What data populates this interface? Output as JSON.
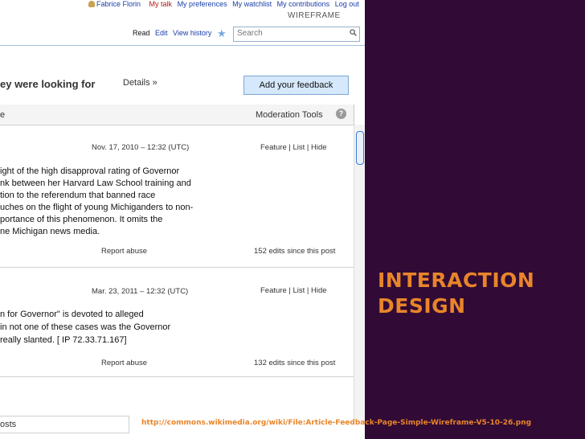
{
  "topbar": {
    "user": "Fabrice Florin",
    "my_talk": "My talk",
    "my_preferences": "My preferences",
    "my_watchlist": "My watchlist",
    "my_contributions": "My contributions",
    "logout": "Log out"
  },
  "wireframe_label": "WIREFRAME",
  "tabs": {
    "read": "Read",
    "edit": "Edit",
    "view_history": "View history"
  },
  "search": {
    "placeholder": "Search"
  },
  "headline": "ey were looking for",
  "details_link": "Details  »",
  "add_feedback_button": "Add your feedback",
  "panel": {
    "header_left": "e",
    "moderation_tools": "Moderation Tools",
    "help": "?"
  },
  "posts": [
    {
      "date": "Nov. 17, 2010 – 12:32 (UTC)",
      "actions": "Feature | List | Hide",
      "lines": [
        "ight of the high disapproval rating of Governor",
        "nk between her Harvard Law School training and",
        "tion to the referendum that banned race",
        "uches on the flight of young Michiganders to non-",
        "portance of this phenomenon.  It omits the",
        "ne Michigan news media."
      ],
      "report": "Report abuse",
      "edits": "152 edits since this post"
    },
    {
      "date": "Mar. 23, 2011 – 12:32 (UTC)",
      "actions": "Feature | List | Hide",
      "lines": [
        "n for Governor\" is devoted to alleged",
        "in not one of these cases was the Governor",
        "really slanted. [ IP 72.33.71.167]"
      ],
      "report": "Report abuse",
      "edits": "132 edits since this post"
    }
  ],
  "bottom_label": "osts",
  "slide": {
    "title_line1": "INTERACTION",
    "title_line2": "DESIGN",
    "caption": "http://commons.wikimedia.org/wiki/File:Article-Feedback-Page-Simple-Wireframe-V5-10-26.png",
    "accent_color": "#e8852a",
    "background_color": "#310a35"
  }
}
